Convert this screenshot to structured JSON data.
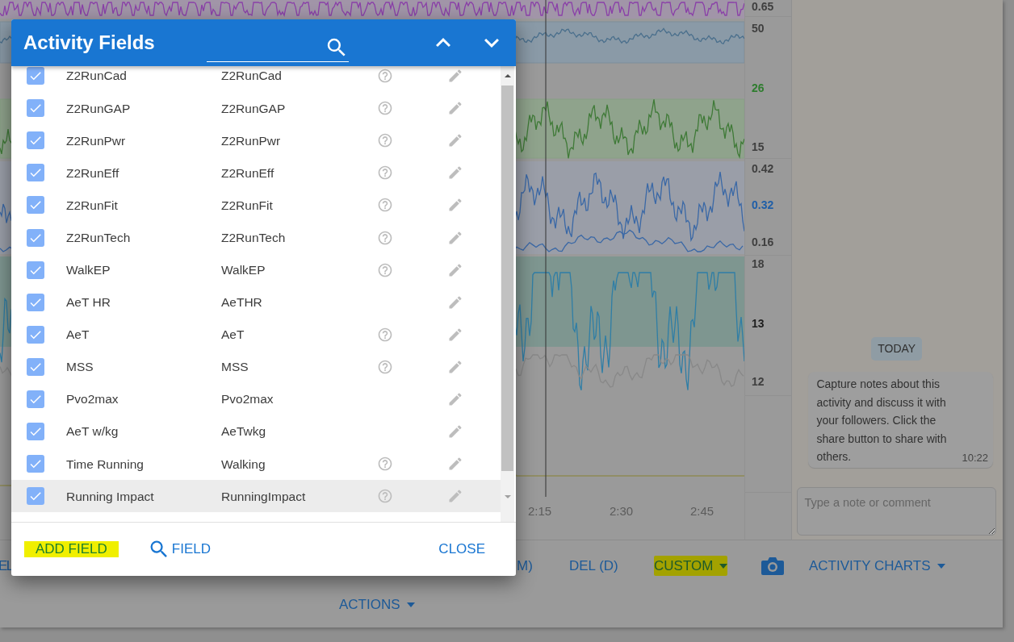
{
  "background": {
    "axis_labels": [
      {
        "text": "0.65",
        "color": "#3f3f3f"
      },
      {
        "text": "50",
        "color": "#3f3f3f"
      },
      {
        "text": "26",
        "color": "#2f7d2f"
      },
      {
        "text": "15",
        "color": "#3f3f3f"
      },
      {
        "text": "0.42",
        "color": "#3f3f3f"
      },
      {
        "text": "0.32",
        "color": "#1f5fa8"
      },
      {
        "text": "0.16",
        "color": "#3f3f3f"
      },
      {
        "text": "18",
        "color": "#3f3f3f"
      },
      {
        "text": "13",
        "color": "#1e1e1e"
      },
      {
        "text": "12",
        "color": "#3f3f3f"
      }
    ],
    "time_ticks": [
      "2:15",
      "2:30",
      "2:45"
    ],
    "chat": {
      "day_label": "TODAY",
      "message": {
        "text": "Capture notes about this activity and discuss it with your followers. Click the share button to share with others.",
        "time": "10:22"
      },
      "input": {
        "placeholder": "Type a note or comment"
      }
    },
    "toolbar": {
      "items": [
        {
          "kind": "text",
          "label": "EL",
          "highlighted": false
        },
        {
          "kind": "text",
          "label": "M)",
          "highlighted": false
        },
        {
          "kind": "text",
          "label": "DEL (D)",
          "highlighted": false
        },
        {
          "kind": "dropdown",
          "label": "CUSTOM",
          "highlighted": true
        },
        {
          "kind": "camera"
        },
        {
          "kind": "dropdown",
          "label": "ACTIVITY CHARTS",
          "highlighted": false
        }
      ],
      "second_row": [
        {
          "kind": "dropdown",
          "label": "ACTIONS",
          "highlighted": false
        }
      ]
    }
  },
  "dialog": {
    "title": "Activity Fields",
    "fields": [
      {
        "name": "Z2RunCad",
        "key": "Z2RunCad",
        "checked": true,
        "has_help": true,
        "selected": false
      },
      {
        "name": "Z2RunGAP",
        "key": "Z2RunGAP",
        "checked": true,
        "has_help": true,
        "selected": false
      },
      {
        "name": "Z2RunPwr",
        "key": "Z2RunPwr",
        "checked": true,
        "has_help": true,
        "selected": false
      },
      {
        "name": "Z2RunEff",
        "key": "Z2RunEff",
        "checked": true,
        "has_help": true,
        "selected": false
      },
      {
        "name": "Z2RunFit",
        "key": "Z2RunFit",
        "checked": true,
        "has_help": true,
        "selected": false
      },
      {
        "name": "Z2RunTech",
        "key": "Z2RunTech",
        "checked": true,
        "has_help": true,
        "selected": false
      },
      {
        "name": "WalkEP",
        "key": "WalkEP",
        "checked": true,
        "has_help": true,
        "selected": false
      },
      {
        "name": "AeT HR",
        "key": "AeTHR",
        "checked": true,
        "has_help": false,
        "selected": false
      },
      {
        "name": "AeT",
        "key": "AeT",
        "checked": true,
        "has_help": true,
        "selected": false
      },
      {
        "name": "MSS",
        "key": "MSS",
        "checked": true,
        "has_help": true,
        "selected": false
      },
      {
        "name": "Pvo2max",
        "key": "Pvo2max",
        "checked": true,
        "has_help": false,
        "selected": false
      },
      {
        "name": "AeT w/kg",
        "key": "AeTwkg",
        "checked": true,
        "has_help": false,
        "selected": false
      },
      {
        "name": "Time Running",
        "key": "Walking",
        "checked": true,
        "has_help": true,
        "selected": false
      },
      {
        "name": "Running Impact",
        "key": "RunningImpact",
        "checked": true,
        "has_help": true,
        "selected": true
      }
    ],
    "footer": [
      {
        "kind": "text",
        "label": "ADD FIELD",
        "highlighted": true
      },
      {
        "kind": "search",
        "label": "FIELD",
        "highlighted": false
      },
      {
        "kind": "text",
        "label": "CLOSE",
        "highlighted": false
      }
    ]
  }
}
